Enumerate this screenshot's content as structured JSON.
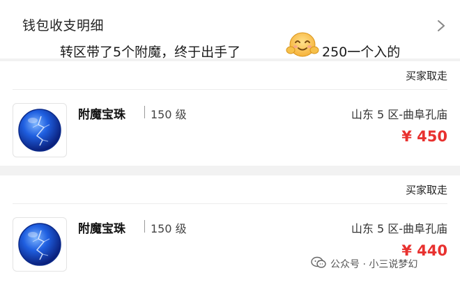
{
  "header": {
    "title": "钱包收支明细",
    "chevron_icon": "chevron-right-icon"
  },
  "caption": {
    "text_before": "转区带了5个附魔，终于出手了",
    "emoji_icon": "smiling-face-icon",
    "text_after": "250一个入的"
  },
  "orders": [
    {
      "status": "买家取走",
      "item_icon": "blue-orb-icon",
      "name": "附魔宝珠",
      "level": "150 级",
      "server": "山东 5 区-曲阜孔庙",
      "price": "¥ 450"
    },
    {
      "status": "买家取走",
      "item_icon": "blue-orb-icon",
      "name": "附魔宝珠",
      "level": "150 级",
      "server": "山东 5 区-曲阜孔庙",
      "price": "¥ 440"
    }
  ],
  "watermark": {
    "icon": "wechat-icon",
    "text": "公众号 · 小三说梦幻"
  },
  "colors": {
    "price": "#e8312f",
    "background": "#f2f2f2",
    "card": "#ffffff"
  }
}
